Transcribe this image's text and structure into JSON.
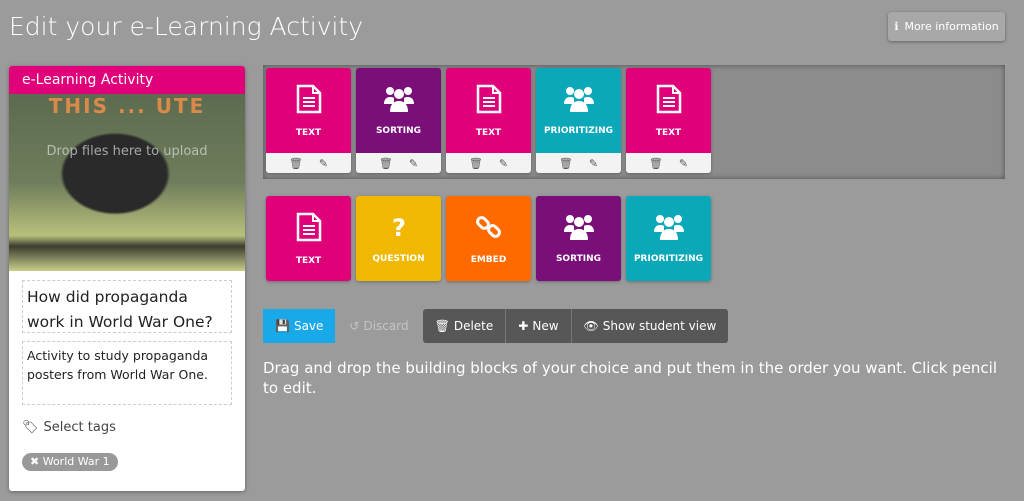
{
  "page_title": "Edit your e-Learning Activity",
  "more_info": {
    "label": "More information",
    "icon": "info-icon"
  },
  "card": {
    "header": "e-Learning Activity",
    "image_alt_text": "THIS ... UTE",
    "drop_text": "Drop files here to upload",
    "title_value": "How did propaganda work in World War One?",
    "description_value": "Activity to study propaganda posters from World War One.",
    "select_tags": "Select tags",
    "tags": [
      "World War 1"
    ]
  },
  "colors": {
    "text": "#e0007a",
    "sorting": "#7a0f7a",
    "prioritizing": "#0aa8b8",
    "question": "#f0b800",
    "embed": "#ff6a00",
    "save": "#1aa9e8",
    "dark_btn": "#575757"
  },
  "activity_blocks": [
    {
      "label": "TEXT",
      "type": "text"
    },
    {
      "label": "SORTING",
      "type": "sorting"
    },
    {
      "label": "TEXT",
      "type": "text"
    },
    {
      "label": "PRIORITIZING",
      "type": "prioritizing"
    },
    {
      "label": "TEXT",
      "type": "text"
    }
  ],
  "palette_blocks": [
    {
      "label": "TEXT",
      "type": "text"
    },
    {
      "label": "QUESTION",
      "type": "question"
    },
    {
      "label": "EMBED",
      "type": "embed"
    },
    {
      "label": "SORTING",
      "type": "sorting"
    },
    {
      "label": "PRIORITIZING",
      "type": "prioritizing"
    }
  ],
  "buttons": {
    "save": "Save",
    "discard": "Discard",
    "delete": "Delete",
    "new": "New",
    "show_student_view": "Show student view"
  },
  "instructions": "Drag and drop the building blocks of your choice and put them in the order you want. Click pencil to edit."
}
